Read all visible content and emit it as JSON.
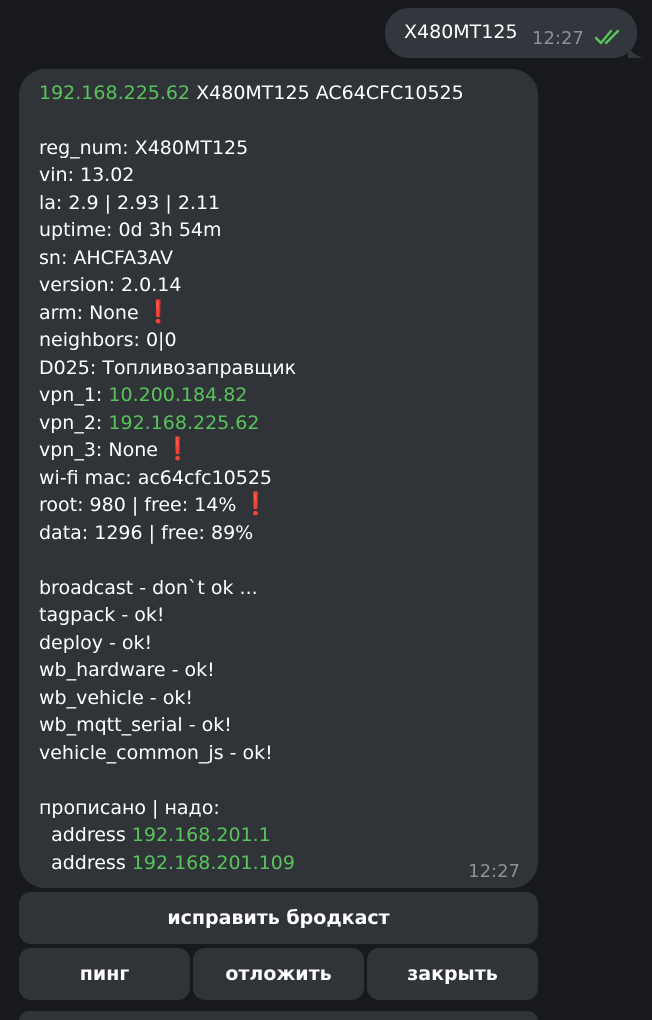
{
  "outgoing": {
    "text": "X480MT125",
    "time": "12:27",
    "check_icon": "double-check-icon",
    "check_color": "#58c45b"
  },
  "message": {
    "header": {
      "ip": "192.168.225.62",
      "rest": " X480MT125 AC64CFC10525"
    },
    "lines": [
      "reg_num: X480MT125",
      "vin: 13.02",
      "la: 2.9 | 2.93 | 2.11",
      "uptime: 0d 3h 54m",
      "sn: AHCFA3AV",
      "version: 2.0.14",
      "arm: None",
      "neighbors: 0|0",
      "D025: Топливозаправщик",
      "vpn_1: ",
      "vpn_2: ",
      "vpn_3: None",
      "wi-fi mac: ac64cfc10525",
      "root: 980 | free: 14%",
      "data: 1296 | free: 89%"
    ],
    "vpn_1_ip": "10.200.184.82",
    "vpn_2_ip": "192.168.225.62",
    "warning_mark": "❗",
    "services": [
      "broadcast - don`t ok ...",
      "tagpack - ok!",
      "deploy - ok!",
      "wb_hardware - ok!",
      "wb_vehicle - ok!",
      "wb_mqtt_serial - ok!",
      "vehicle_common_js - ok!"
    ],
    "routes_title": "прописано | надо:",
    "address_label": "  address ",
    "address_1": "192.168.201.1",
    "address_2": "192.168.201.109",
    "time": "12:27"
  },
  "keyboard": {
    "fix_broadcast": "исправить бродкаст",
    "ping": "пинг",
    "postpone": "отложить",
    "close": "закрыть"
  },
  "colors": {
    "background": "#17191c",
    "bubble": "#303338",
    "link_green": "#58c45b",
    "warning_red": "#e0262d"
  }
}
